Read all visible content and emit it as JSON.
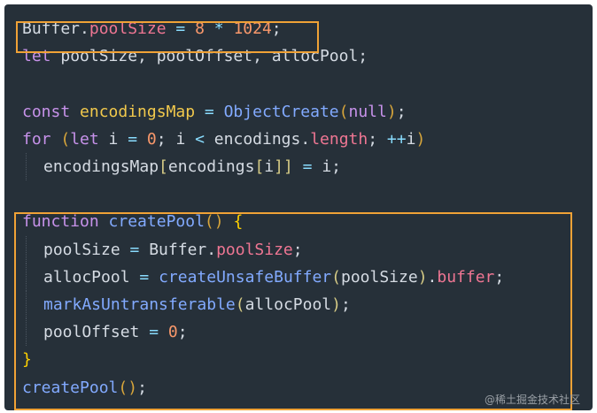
{
  "colors": {
    "background": "#263039",
    "highlight_box": "#f0a236",
    "default": "#d5dbe3",
    "keyword": "#c792ea",
    "property": "#ef7693",
    "number": "#f9986b",
    "operator": "#89ddff",
    "function": "#82aaff",
    "definition": "#f2c94c"
  },
  "code": {
    "lines": [
      [
        [
          "Buffer.",
          "default"
        ],
        [
          "poolSize",
          "prop"
        ],
        [
          " = ",
          "op"
        ],
        [
          "8",
          "num"
        ],
        [
          " * ",
          "op"
        ],
        [
          "1024",
          "num"
        ],
        [
          ";",
          "default"
        ]
      ],
      [
        [
          "let",
          "kw"
        ],
        [
          " poolSize, poolOffset, allocPool;",
          "default"
        ]
      ],
      [],
      [
        [
          "const",
          "kw"
        ],
        [
          " ",
          "default"
        ],
        [
          "encodingsMap",
          "def"
        ],
        [
          " = ",
          "op"
        ],
        [
          "ObjectCreate",
          "fn"
        ],
        [
          "(",
          "paren1"
        ],
        [
          "null",
          "kw"
        ],
        [
          ")",
          "paren1"
        ],
        [
          ";",
          "default"
        ]
      ],
      [
        [
          "for",
          "kw"
        ],
        [
          " ",
          "default"
        ],
        [
          "(",
          "paren1"
        ],
        [
          "let",
          "kw"
        ],
        [
          " i ",
          "default"
        ],
        [
          "=",
          "op"
        ],
        [
          " ",
          "default"
        ],
        [
          "0",
          "num"
        ],
        [
          "; i ",
          "default"
        ],
        [
          "<",
          "op"
        ],
        [
          " encodings.",
          "default"
        ],
        [
          "length",
          "prop"
        ],
        [
          "; ",
          "default"
        ],
        [
          "++",
          "op"
        ],
        [
          "i",
          "default"
        ],
        [
          ")",
          "paren1"
        ]
      ],
      [
        [
          "encodingsMap",
          "default"
        ],
        [
          "[",
          "paren2"
        ],
        [
          "encodings",
          "default"
        ],
        [
          "[",
          "paren2"
        ],
        [
          "i",
          "default"
        ],
        [
          "]",
          "paren2"
        ],
        [
          "]",
          "paren2"
        ],
        [
          " = ",
          "op"
        ],
        [
          "i;",
          "default"
        ]
      ],
      [],
      [
        [
          "function",
          "kw"
        ],
        [
          " ",
          "default"
        ],
        [
          "createPool",
          "fn"
        ],
        [
          "()",
          "paren1"
        ],
        [
          " ",
          "default"
        ],
        [
          "{",
          "brace"
        ]
      ],
      [
        [
          "poolSize",
          "default"
        ],
        [
          " = ",
          "op"
        ],
        [
          "Buffer.",
          "default"
        ],
        [
          "poolSize",
          "prop"
        ],
        [
          ";",
          "default"
        ]
      ],
      [
        [
          "allocPool",
          "default"
        ],
        [
          " = ",
          "op"
        ],
        [
          "createUnsafeBuffer",
          "fn"
        ],
        [
          "(",
          "paren2"
        ],
        [
          "poolSize",
          "default"
        ],
        [
          ")",
          "paren2"
        ],
        [
          ".",
          "default"
        ],
        [
          "buffer",
          "prop"
        ],
        [
          ";",
          "default"
        ]
      ],
      [
        [
          "markAsUntransferable",
          "fn"
        ],
        [
          "(",
          "paren2"
        ],
        [
          "allocPool",
          "default"
        ],
        [
          ")",
          "paren2"
        ],
        [
          ";",
          "default"
        ]
      ],
      [
        [
          "poolOffset",
          "default"
        ],
        [
          " = ",
          "op"
        ],
        [
          "0",
          "num"
        ],
        [
          ";",
          "default"
        ]
      ],
      [
        [
          "}",
          "brace"
        ]
      ],
      [
        [
          "createPool",
          "fn"
        ],
        [
          "()",
          "paren1"
        ],
        [
          ";",
          "default"
        ]
      ]
    ],
    "indented_lines": [
      5,
      8,
      9,
      10,
      11
    ]
  },
  "watermark": "@稀土掘金技术社区"
}
